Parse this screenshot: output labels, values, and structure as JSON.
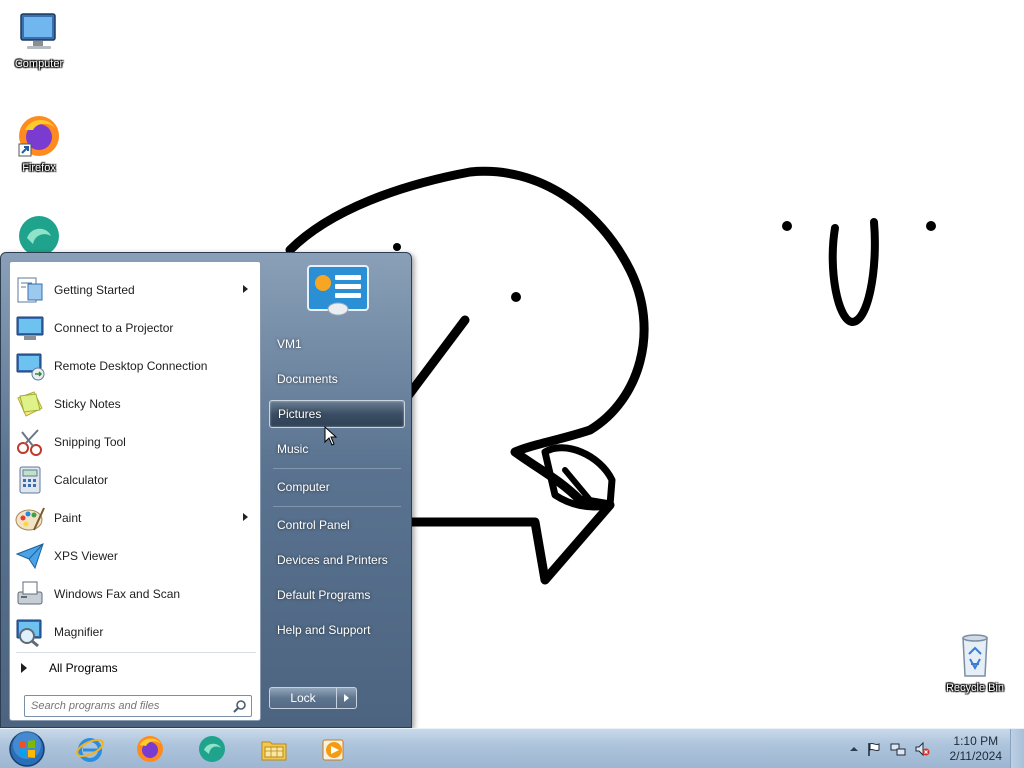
{
  "desktop": {
    "icons": [
      {
        "label": "Computer",
        "icon": "computer-icon"
      },
      {
        "label": "Firefox",
        "icon": "firefox-icon"
      },
      {
        "label": "Recycle Bin",
        "icon": "recycle-bin-icon"
      }
    ]
  },
  "start_menu": {
    "programs": [
      {
        "label": "Getting Started",
        "icon": "getting-started-icon",
        "submenu": true
      },
      {
        "label": "Connect to a Projector",
        "icon": "projector-icon",
        "submenu": false
      },
      {
        "label": "Remote Desktop Connection",
        "icon": "remote-desktop-icon",
        "submenu": false
      },
      {
        "label": "Sticky Notes",
        "icon": "sticky-notes-icon",
        "submenu": false
      },
      {
        "label": "Snipping Tool",
        "icon": "snipping-tool-icon",
        "submenu": false
      },
      {
        "label": "Calculator",
        "icon": "calculator-icon",
        "submenu": false
      },
      {
        "label": "Paint",
        "icon": "paint-icon",
        "submenu": true
      },
      {
        "label": "XPS Viewer",
        "icon": "xps-viewer-icon",
        "submenu": false
      },
      {
        "label": "Windows Fax and Scan",
        "icon": "fax-scan-icon",
        "submenu": false
      },
      {
        "label": "Magnifier",
        "icon": "magnifier-icon",
        "submenu": false
      }
    ],
    "all_programs_label": "All Programs",
    "search_placeholder": "Search programs and files",
    "places": [
      {
        "label": "VM1"
      },
      {
        "label": "Documents"
      },
      {
        "label": "Pictures",
        "highlighted": true
      },
      {
        "label": "Music"
      },
      {
        "label": "Computer"
      },
      {
        "label": "Control Panel"
      },
      {
        "label": "Devices and Printers"
      },
      {
        "label": "Default Programs"
      },
      {
        "label": "Help and Support"
      }
    ],
    "lock_label": "Lock"
  },
  "taskbar": {
    "pinned": [
      {
        "icon": "internet-explorer-icon"
      },
      {
        "icon": "firefox-icon"
      },
      {
        "icon": "app-icon"
      },
      {
        "icon": "file-explorer-icon"
      },
      {
        "icon": "media-player-icon"
      }
    ],
    "clock": {
      "time": "1:10 PM",
      "date": "2/11/2024"
    }
  },
  "colors": {
    "menu_frame": "#5a7390",
    "taskbar": "#adc4dc",
    "accent": "#1e5aa8"
  }
}
